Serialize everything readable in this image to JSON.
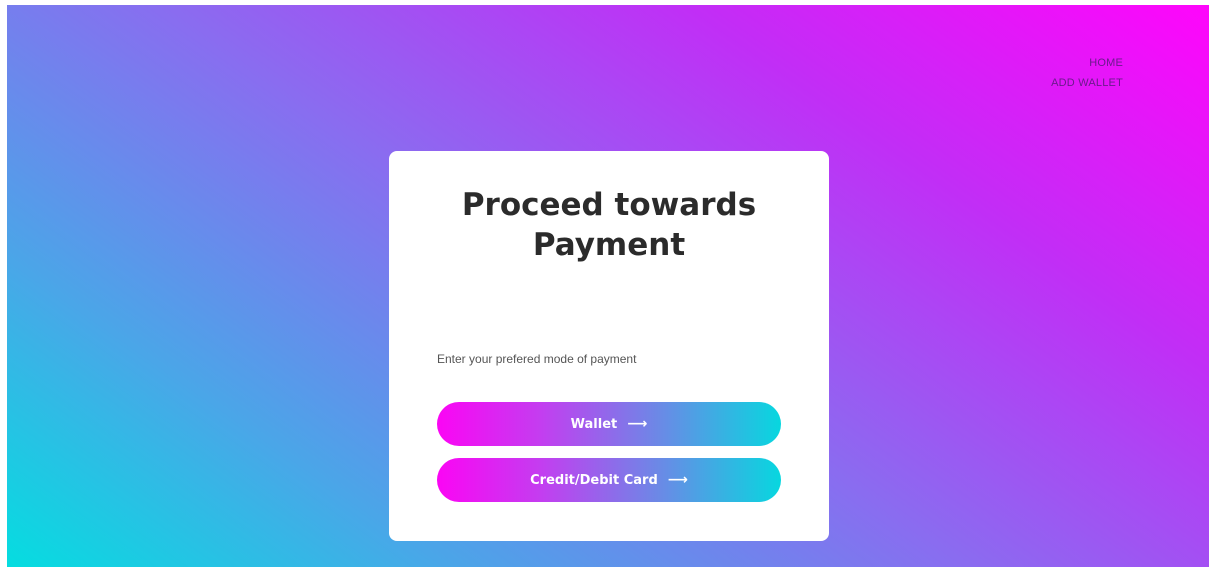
{
  "nav": {
    "items": [
      {
        "label": "HOME"
      },
      {
        "label": "ADD WALLET"
      }
    ]
  },
  "card": {
    "title": "Proceed towards Payment",
    "prompt": "Enter your prefered mode of payment",
    "buttons": [
      {
        "label": "Wallet",
        "icon": "arrow-right-icon"
      },
      {
        "label": "Credit/Debit Card",
        "icon": "arrow-right-icon"
      }
    ]
  },
  "colors": {
    "gradient_start": "#05dde0",
    "gradient_end": "#ff05fb",
    "button_left": "#fb05f4",
    "button_right": "#07d7df",
    "title_text": "#2b2b2b",
    "nav_text": "#6b1a8c"
  }
}
